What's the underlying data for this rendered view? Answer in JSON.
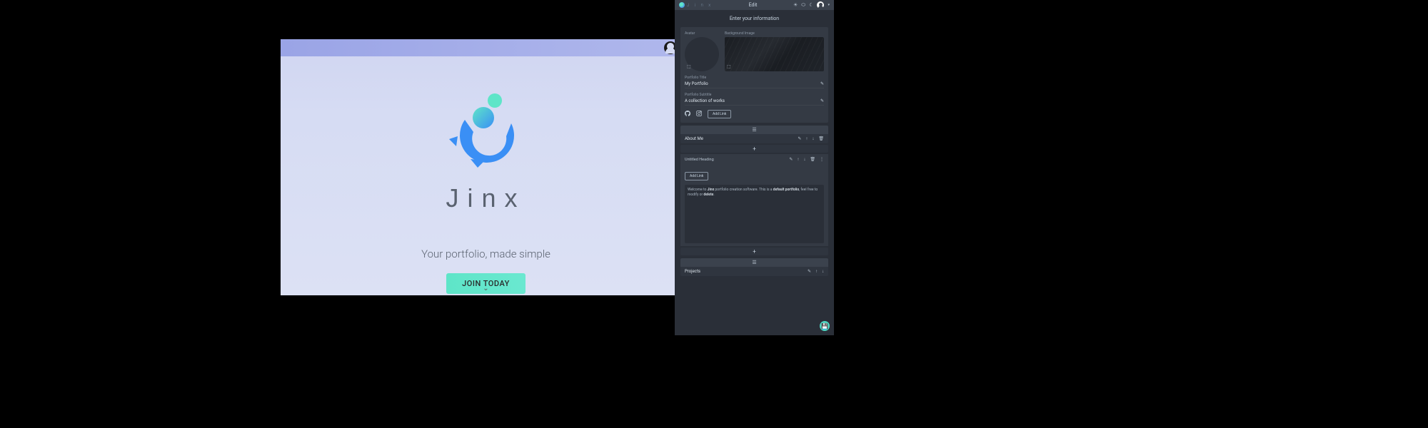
{
  "left": {
    "brand": "Jinx",
    "tagline": "Your portfolio, made simple",
    "cta": "JOIN TODAY"
  },
  "right": {
    "brand": "J i n x",
    "pageTitle": "Edit",
    "subtitle": "Enter your information",
    "infoPanel": {
      "avatarLabel": "Avatar",
      "bgLabel": "Background Image",
      "titleLabel": "Portfolio Title",
      "titleValue": "My Portfolio",
      "subtitleLabel": "Portfolio Subtitle",
      "subtitleValue": "A collection of works",
      "addLink": "Add Link"
    },
    "section1": {
      "name": "About Me",
      "block": {
        "name": "Untitled Heading",
        "addLink": "Add Link",
        "bodyPrefix": "Welcome to ",
        "bodyBold1": "Jinx",
        "bodyMid": " portfolio creation software. This is a ",
        "bodyBold2": "default portfolio",
        "bodySuffix": ", feel free to modify or ",
        "bodyBold3": "delete",
        "bodyEnd": "."
      }
    },
    "section2": {
      "name": "Projects"
    }
  }
}
